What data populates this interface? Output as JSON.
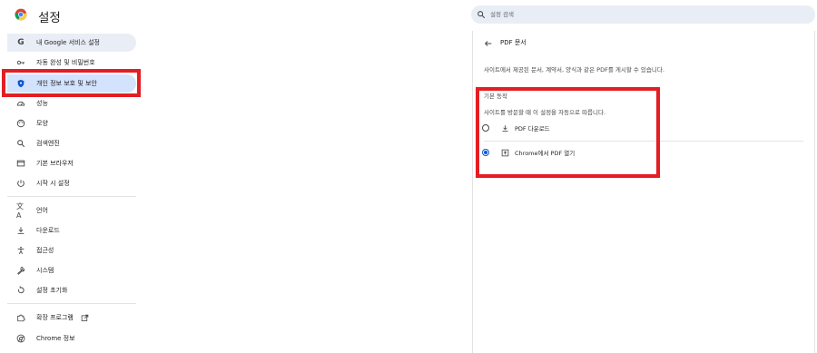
{
  "header": {
    "title": "설정",
    "search_placeholder": "설정 검색"
  },
  "sidebar": {
    "items": [
      {
        "label": "내 Google 서비스 설정",
        "icon": "google-g-icon"
      },
      {
        "label": "자동 완성 및 비밀번호",
        "icon": "key-icon"
      },
      {
        "label": "개인 정보 보호 및 보안",
        "icon": "shield-icon"
      },
      {
        "label": "성능",
        "icon": "speedometer-icon"
      },
      {
        "label": "모양",
        "icon": "palette-icon"
      },
      {
        "label": "검색엔진",
        "icon": "search-icon"
      },
      {
        "label": "기본 브라우저",
        "icon": "browser-window-icon"
      },
      {
        "label": "시작 시 설정",
        "icon": "power-icon"
      },
      {
        "label": "언어",
        "icon": "translate-icon"
      },
      {
        "label": "다운로드",
        "icon": "download-icon"
      },
      {
        "label": "접근성",
        "icon": "accessibility-icon"
      },
      {
        "label": "시스템",
        "icon": "wrench-icon"
      },
      {
        "label": "설정 초기화",
        "icon": "reset-icon"
      },
      {
        "label": "확장 프로그램",
        "icon": "puzzle-icon"
      },
      {
        "label": "Chrome 정보",
        "icon": "chrome-icon"
      }
    ]
  },
  "panel": {
    "title": "PDF 문서",
    "description": "사이트에서 제공된 문서, 계약서, 양식과 같은 PDF를 게시할 수 있습니다.",
    "section_heading": "기본 동작",
    "section_sub": "사이트를 방문할 때 이 설정을 자동으로 따릅니다.",
    "options": [
      {
        "label": "PDF 다운로드",
        "checked": false,
        "icon": "download-icon"
      },
      {
        "label": "Chrome에서 PDF 열기",
        "checked": true,
        "icon": "open-in-icon"
      }
    ]
  },
  "colors": {
    "accent": "#0b57d0",
    "highlight_box": "#e31e24",
    "selected_bg": "#e9eef6",
    "active_bg": "#d3e3fd"
  }
}
